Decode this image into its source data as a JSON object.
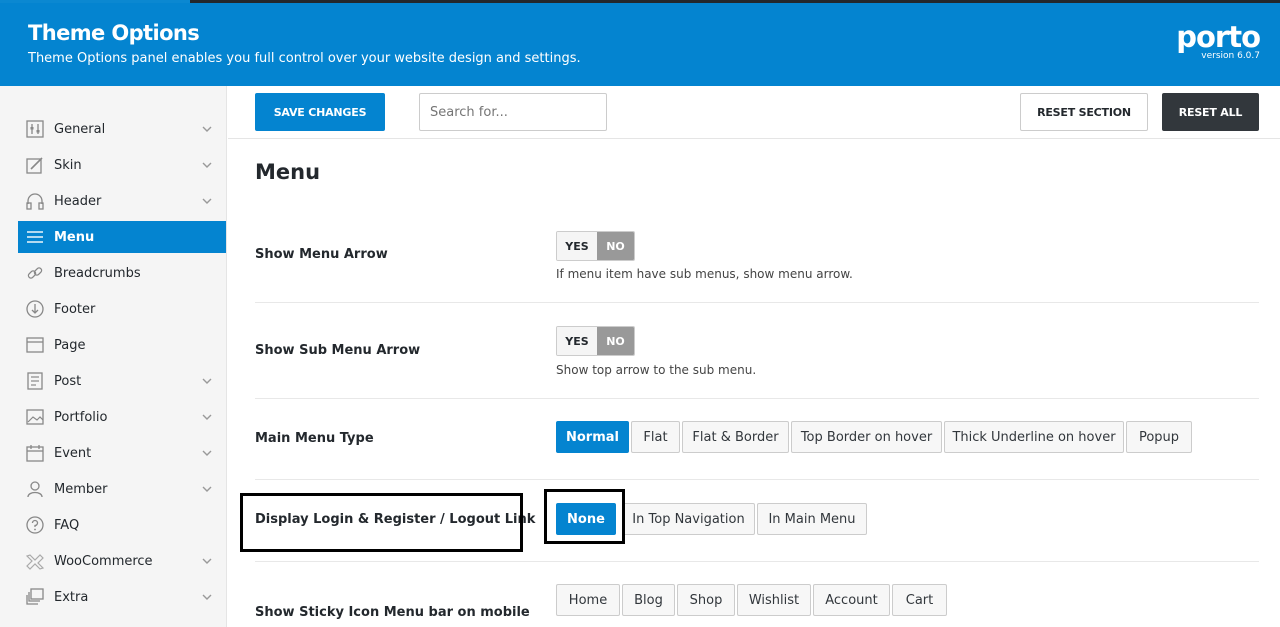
{
  "header": {
    "title": "Theme Options",
    "subtitle": "Theme Options panel enables you full control over your website design and settings.",
    "logo_text": "porto",
    "version": "version 6.0.7"
  },
  "toolbar": {
    "save_label": "SAVE CHANGES",
    "search_placeholder": "Search for...",
    "reset_section_label": "RESET SECTION",
    "reset_all_label": "RESET ALL"
  },
  "sidebar": {
    "items": [
      {
        "label": "General",
        "icon": "sliders-icon",
        "has_children": true
      },
      {
        "label": "Skin",
        "icon": "brush-icon",
        "has_children": true
      },
      {
        "label": "Header",
        "icon": "headphones-icon",
        "has_children": true
      },
      {
        "label": "Menu",
        "icon": "menu-icon",
        "has_children": false,
        "active": true
      },
      {
        "label": "Breadcrumbs",
        "icon": "link-icon",
        "has_children": false
      },
      {
        "label": "Footer",
        "icon": "arrow-down-circle-icon",
        "has_children": false
      },
      {
        "label": "Page",
        "icon": "window-icon",
        "has_children": false
      },
      {
        "label": "Post",
        "icon": "document-icon",
        "has_children": true
      },
      {
        "label": "Portfolio",
        "icon": "image-icon",
        "has_children": true
      },
      {
        "label": "Event",
        "icon": "calendar-icon",
        "has_children": true
      },
      {
        "label": "Member",
        "icon": "user-icon",
        "has_children": true
      },
      {
        "label": "FAQ",
        "icon": "question-icon",
        "has_children": false
      },
      {
        "label": "WooCommerce",
        "icon": "woocommerce-icon",
        "has_children": true
      },
      {
        "label": "Extra",
        "icon": "stack-icon",
        "has_children": true
      }
    ]
  },
  "main": {
    "section_title": "Menu",
    "show_menu_arrow": {
      "label": "Show Menu Arrow",
      "yes": "YES",
      "no": "NO",
      "value": "NO",
      "description": "If menu item have sub menus, show menu arrow."
    },
    "show_sub_menu_arrow": {
      "label": "Show Sub Menu Arrow",
      "yes": "YES",
      "no": "NO",
      "value": "NO",
      "description": "Show top arrow to the sub menu."
    },
    "main_menu_type": {
      "label": "Main Menu Type",
      "options": [
        "Normal",
        "Flat",
        "Flat & Border",
        "Top Border on hover",
        "Thick Underline on hover",
        "Popup"
      ],
      "selected": "Normal"
    },
    "display_login": {
      "label": "Display Login & Register / Logout Link",
      "options": [
        "None",
        "In Top Navigation",
        "In Main Menu"
      ],
      "selected": "None"
    },
    "sticky_icon_menu": {
      "label": "Show Sticky Icon Menu bar on mobile",
      "options": [
        "Home",
        "Blog",
        "Shop",
        "Wishlist",
        "Account",
        "Cart"
      ]
    }
  },
  "colors": {
    "accent": "#0484d0",
    "dark": "#32373c",
    "highlight": "#000000"
  }
}
